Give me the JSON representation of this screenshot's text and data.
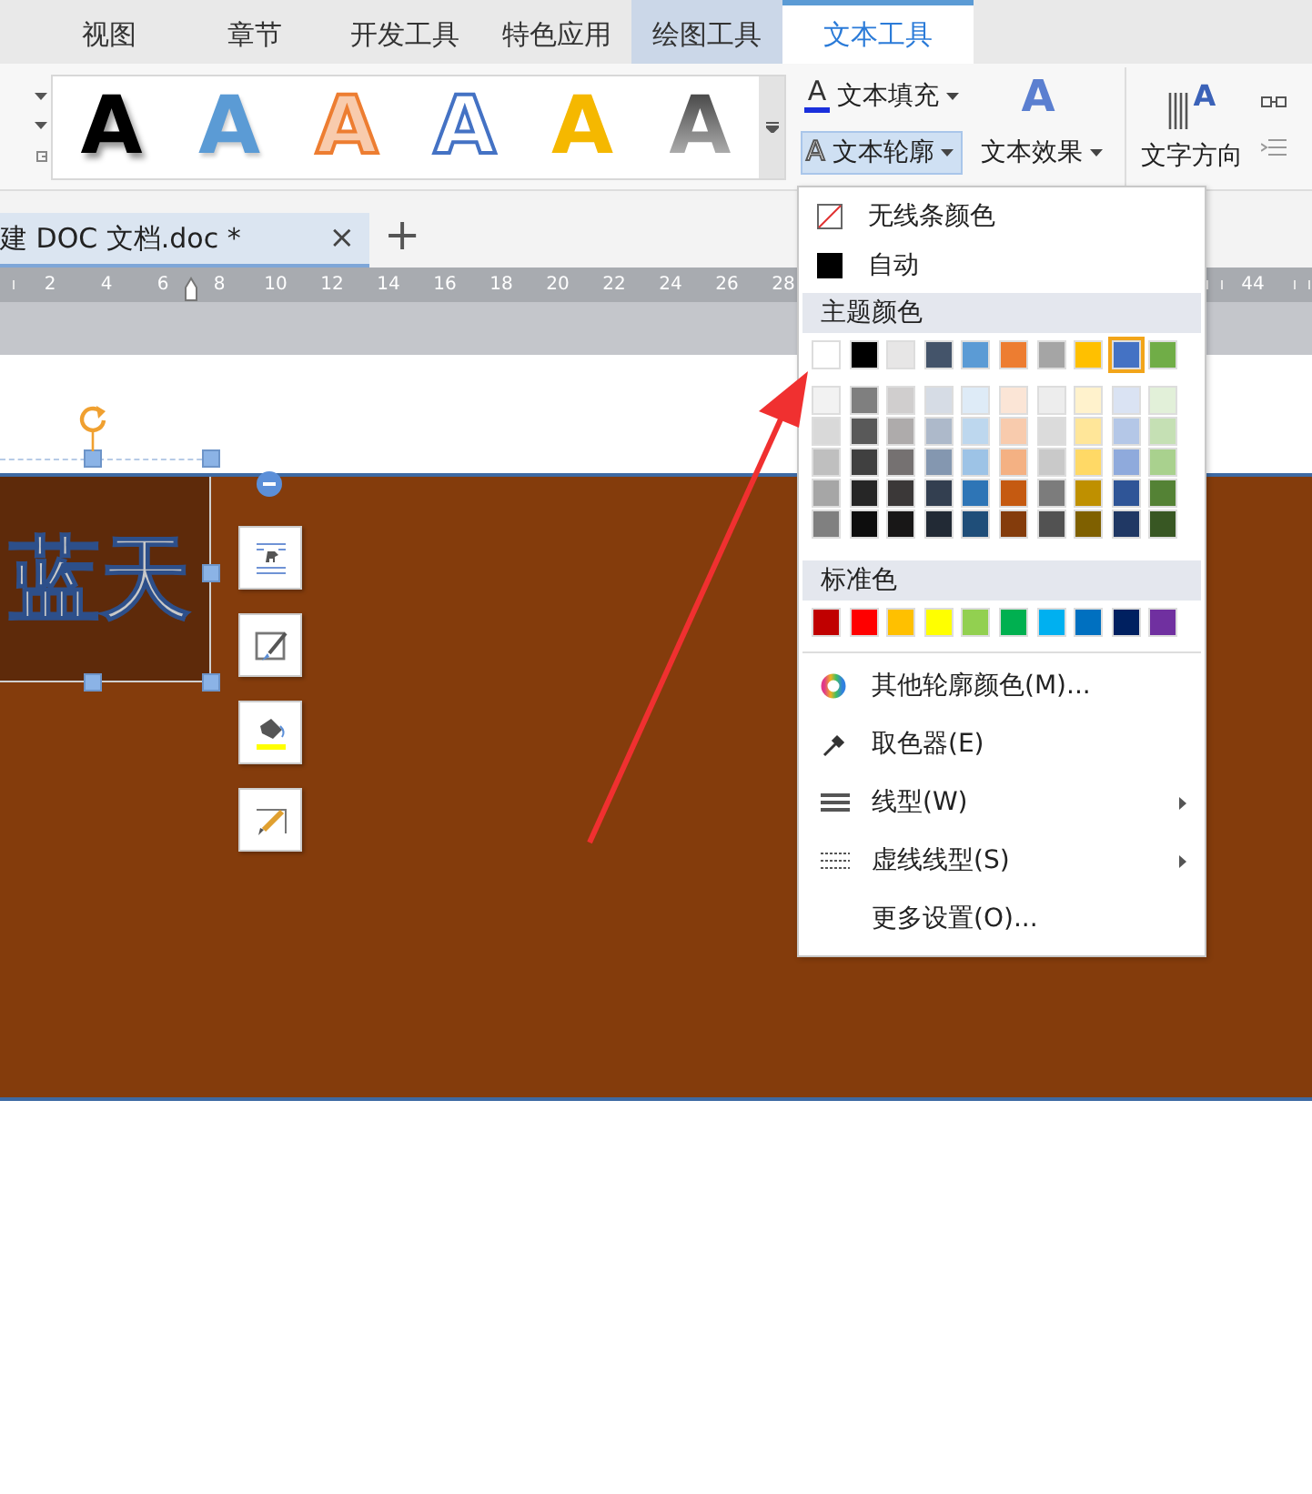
{
  "app_tabs": [
    {
      "label": "视图",
      "selected": false,
      "contextual": false
    },
    {
      "label": "章节",
      "selected": false,
      "contextual": false
    },
    {
      "label": "开发工具",
      "selected": false,
      "contextual": false
    },
    {
      "label": "特色应用",
      "selected": false,
      "contextual": false
    },
    {
      "label": "绘图工具",
      "selected": false,
      "contextual": true
    },
    {
      "label": "文本工具",
      "selected": true,
      "contextual": true
    }
  ],
  "ribbon": {
    "styles": [
      {
        "letter": "A",
        "kind": "black-shadow"
      },
      {
        "letter": "A",
        "kind": "blue"
      },
      {
        "letter": "A",
        "kind": "orange-outline"
      },
      {
        "letter": "A",
        "kind": "blue-outline"
      },
      {
        "letter": "A",
        "kind": "gold"
      },
      {
        "letter": "A",
        "kind": "gray-gradient"
      }
    ],
    "fill_button": {
      "glyph": "A",
      "label": "文本填充",
      "pressed": false
    },
    "outline_button": {
      "glyph": "A",
      "label": "文本轮廓",
      "pressed": true
    },
    "effect_icon": {
      "glyph": "A"
    },
    "effect_button": {
      "label": "文本效果",
      "pressed": false
    },
    "direction_button": {
      "glyph": "A",
      "label": "文字方向"
    }
  },
  "doc_tab": {
    "title": "建 DOC 文档.doc *",
    "close": "×",
    "new_tab": "+"
  },
  "ruler": {
    "labels": [
      "2",
      "4",
      "6",
      "8",
      "10",
      "12",
      "14",
      "16",
      "18",
      "20",
      "22",
      "24",
      "26",
      "28"
    ],
    "right_labels": [
      "44"
    ]
  },
  "document": {
    "textbox_text": "蓝天"
  },
  "outline_menu": {
    "top_items": [
      {
        "label": "无线条颜色",
        "kind": "no-line"
      },
      {
        "label": "自动",
        "kind": "auto"
      }
    ],
    "theme_header": "主题颜色",
    "theme_colors": [
      {
        "color": "#ffffff",
        "selected": false
      },
      {
        "color": "#000000",
        "selected": false
      },
      {
        "color": "#e7e6e6",
        "selected": false
      },
      {
        "color": "#44546a",
        "selected": false
      },
      {
        "color": "#5b9bd5",
        "selected": false
      },
      {
        "color": "#ed7d31",
        "selected": false
      },
      {
        "color": "#a5a5a5",
        "selected": false
      },
      {
        "color": "#ffc000",
        "selected": false
      },
      {
        "color": "#4472c4",
        "selected": true
      },
      {
        "color": "#70ad47",
        "selected": false
      }
    ],
    "shade_rows": [
      [
        {
          "color": "#f2f2f2"
        },
        {
          "color": "#7f7f7f"
        },
        {
          "color": "#d0cece"
        },
        {
          "color": "#d6dce5"
        },
        {
          "color": "#deebf7"
        },
        {
          "color": "#fbe5d6"
        },
        {
          "color": "#ededed"
        },
        {
          "color": "#fff2cc"
        },
        {
          "color": "#dae3f3"
        },
        {
          "color": "#e2f0d9"
        }
      ],
      [
        {
          "color": "#d9d9d9"
        },
        {
          "color": "#595959"
        },
        {
          "color": "#aeabab"
        },
        {
          "color": "#adb9ca"
        },
        {
          "color": "#bdd7ee"
        },
        {
          "color": "#f8cbad"
        },
        {
          "color": "#dbdbdb"
        },
        {
          "color": "#ffe699"
        },
        {
          "color": "#b4c7e7"
        },
        {
          "color": "#c5e0b4"
        }
      ],
      [
        {
          "color": "#bfbfbf"
        },
        {
          "color": "#404040"
        },
        {
          "color": "#757171"
        },
        {
          "color": "#8497b0"
        },
        {
          "color": "#9dc3e6"
        },
        {
          "color": "#f4b183"
        },
        {
          "color": "#c9c9c9"
        },
        {
          "color": "#ffd966"
        },
        {
          "color": "#8faadc"
        },
        {
          "color": "#a9d18e"
        }
      ],
      [
        {
          "color": "#a6a6a6"
        },
        {
          "color": "#262626"
        },
        {
          "color": "#3b3838"
        },
        {
          "color": "#333f50"
        },
        {
          "color": "#2e75b6"
        },
        {
          "color": "#c55a11"
        },
        {
          "color": "#7c7c7c"
        },
        {
          "color": "#bf9000"
        },
        {
          "color": "#2f5597"
        },
        {
          "color": "#548235"
        }
      ],
      [
        {
          "color": "#808080"
        },
        {
          "color": "#0d0d0d"
        },
        {
          "color": "#181717"
        },
        {
          "color": "#222a35"
        },
        {
          "color": "#1f4e79"
        },
        {
          "color": "#843c0c"
        },
        {
          "color": "#525252"
        },
        {
          "color": "#7f6000"
        },
        {
          "color": "#203864"
        },
        {
          "color": "#385723"
        }
      ]
    ],
    "standard_header": "标准色",
    "standard_colors": [
      {
        "color": "#c00000"
      },
      {
        "color": "#ff0000"
      },
      {
        "color": "#ffc000"
      },
      {
        "color": "#ffff00"
      },
      {
        "color": "#92d050"
      },
      {
        "color": "#00b050"
      },
      {
        "color": "#00b0f0"
      },
      {
        "color": "#0070c0"
      },
      {
        "color": "#002060"
      },
      {
        "color": "#7030a0"
      }
    ],
    "bottom_items": [
      {
        "label": "其他轮廓颜色(M)...",
        "kind": "color-wheel",
        "submenu": false
      },
      {
        "label": "取色器(E)",
        "kind": "eyedropper",
        "submenu": false
      },
      {
        "label": "线型(W)",
        "kind": "solid-lines",
        "submenu": true
      },
      {
        "label": "虚线线型(S)",
        "kind": "dashed-lines",
        "submenu": true
      },
      {
        "label": "更多设置(O)...",
        "kind": "plain",
        "submenu": false
      }
    ]
  }
}
